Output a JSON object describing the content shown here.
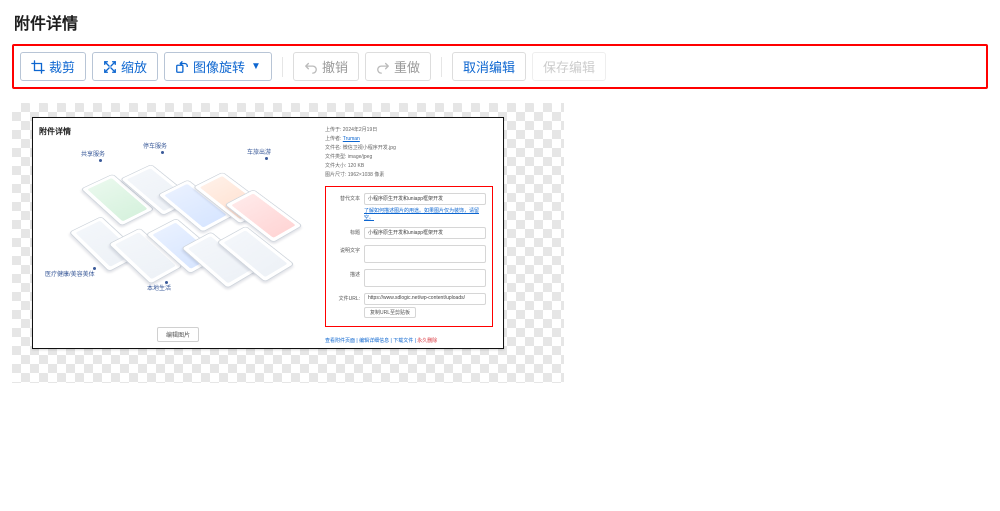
{
  "page_title": "附件详情",
  "toolbar": {
    "crop": "裁剪",
    "scale": "缩放",
    "rotate": "图像旋转",
    "undo": "撤销",
    "redo": "重做",
    "cancel": "取消编辑",
    "save": "保存编辑"
  },
  "screenshot": {
    "inner_title": "附件详情",
    "iso_labels": {
      "share": "共享服务",
      "parking": "停车服务",
      "health": "医疗健康/美容美体",
      "life": "本地生活",
      "travel": "车旅出游"
    },
    "edit_image_btn": "编辑图片",
    "meta": {
      "upload_date_label": "上传于:",
      "upload_date_value": "2024年2月19日",
      "uploader_label": "上传者:",
      "uploader_value": "Truman",
      "filename_label": "文件名:",
      "filename_value": "微信卫视小程序开发.jpg",
      "filetype_label": "文件类型:",
      "filetype_value": "image/jpeg",
      "filesize_label": "文件大小:",
      "filesize_value": "120 KB",
      "dimensions_label": "图片尺寸:",
      "dimensions_value": "1962×1038 像素"
    },
    "form": {
      "alt_label": "替代文本",
      "alt_value": "小程序原生开发和uniapp框架开发",
      "alt_help": "了解如何描述图片的用途。如果图片仅为装饰，请留空。",
      "title_label": "标题",
      "title_value": "小程序原生开发和uniapp框架开发",
      "caption_label": "说明文字",
      "caption_value": "",
      "desc_label": "描述",
      "desc_value": "",
      "url_label": "文件URL:",
      "url_value": "https://www.sdlogic.net/wp-content/uploads/",
      "copy_btn": "复制URL至剪贴板"
    },
    "footer": {
      "view_page": "查看附件页面",
      "edit_details": "编辑详细信息",
      "download": "下载文件",
      "delete": "永久删除"
    }
  }
}
